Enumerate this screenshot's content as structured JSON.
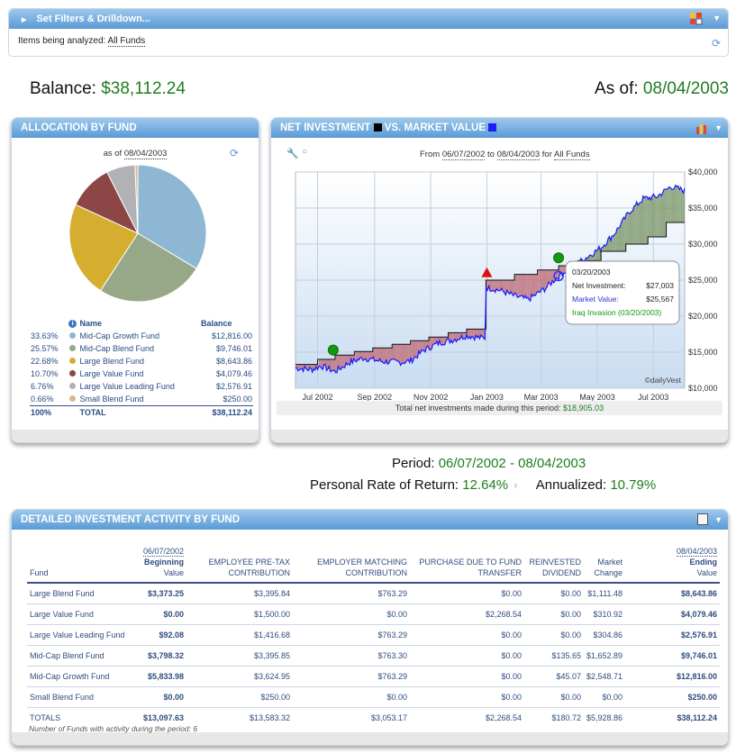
{
  "filters": {
    "header": "Set Filters & Drilldown...",
    "analyzed_label": "Items being analyzed:",
    "analyzed_value": "All Funds"
  },
  "summary": {
    "balance_label": "Balance:",
    "balance_value": "$38,112.24",
    "asof_label": "As of:",
    "asof_value": "08/04/2003"
  },
  "allocation": {
    "title": "Allocation by Fund",
    "asof_prefix": "as of",
    "asof_date": "08/04/2003",
    "col_name": "Name",
    "col_balance": "Balance",
    "rows": [
      {
        "pct": "33.63%",
        "name": "Mid-Cap Growth Fund",
        "balance": "$12,816.00",
        "color": "#8db7d2"
      },
      {
        "pct": "25.57%",
        "name": "Mid-Cap Blend Fund",
        "balance": "$9,746.01",
        "color": "#97a888"
      },
      {
        "pct": "22.68%",
        "name": "Large Blend Fund",
        "balance": "$8,643.86",
        "color": "#d5ad2f"
      },
      {
        "pct": "10.70%",
        "name": "Large Value Fund",
        "balance": "$4,079.46",
        "color": "#8c4646"
      },
      {
        "pct": "6.76%",
        "name": "Large Value Leading Fund",
        "balance": "$2,576.91",
        "color": "#b0b2b6"
      },
      {
        "pct": "0.66%",
        "name": "Small Blend Fund",
        "balance": "$250.00",
        "color": "#d9b889"
      }
    ],
    "total_pct": "100%",
    "total_label": "TOTAL",
    "total_balance": "$38,112.24"
  },
  "netinv": {
    "title_part1": "Net Investment",
    "title_part2": "vs. Market Value",
    "range_from_label": "From",
    "range_from": "06/07/2002",
    "range_to_label": "to",
    "range_to": "08/04/2003",
    "range_for_label": "for",
    "range_for": "All Funds",
    "x_ticks": [
      "Jul 2002",
      "Sep 2002",
      "Nov 2002",
      "Jan 2003",
      "Mar 2003",
      "May 2003",
      "Jul 2003"
    ],
    "y_ticks": [
      "$10,000",
      "$15,000",
      "$20,000",
      "$25,000",
      "$30,000",
      "$35,000",
      "$40,000"
    ],
    "watermark": "©dailyVest",
    "footer_label": "Total net investments made during this period:",
    "footer_value": "$18,905.03",
    "tooltip": {
      "date": "03/20/2003",
      "net_label": "Net Investment:",
      "net_value": "$27,003",
      "mkt_label": "Market Value:",
      "mkt_value": "$25,567",
      "event": "Iraq Invasion (03/20/2003)"
    }
  },
  "chart_data": {
    "type": "area",
    "title": "Net Investment vs. Market Value",
    "x_axis": "date",
    "xlim": [
      "2002-06-07",
      "2003-08-04"
    ],
    "ylim": [
      10000,
      40000
    ],
    "x_ticks": [
      "Jul 2002",
      "Sep 2002",
      "Nov 2002",
      "Jan 2003",
      "Mar 2003",
      "May 2003",
      "Jul 2003"
    ],
    "y_ticks": [
      10000,
      15000,
      20000,
      25000,
      30000,
      35000,
      40000
    ],
    "grid": true,
    "series": [
      {
        "name": "Net Investment",
        "color": "#000000",
        "points": [
          [
            "2002-06-07",
            13300
          ],
          [
            "2002-07-01",
            13300
          ],
          [
            "2002-07-01",
            14000
          ],
          [
            "2002-07-20",
            14000
          ],
          [
            "2002-07-20",
            14600
          ],
          [
            "2002-08-10",
            14600
          ],
          [
            "2002-08-10",
            15100
          ],
          [
            "2002-08-30",
            15100
          ],
          [
            "2002-08-30",
            15600
          ],
          [
            "2002-09-20",
            15600
          ],
          [
            "2002-09-20",
            16100
          ],
          [
            "2002-10-10",
            16100
          ],
          [
            "2002-10-10",
            16600
          ],
          [
            "2002-10-30",
            16600
          ],
          [
            "2002-10-30",
            17100
          ],
          [
            "2002-11-20",
            17100
          ],
          [
            "2002-11-20",
            17700
          ],
          [
            "2002-12-10",
            17700
          ],
          [
            "2002-12-10",
            18200
          ],
          [
            "2002-12-31",
            18200
          ],
          [
            "2002-12-31",
            25000
          ],
          [
            "2003-01-31",
            25000
          ],
          [
            "2003-01-31",
            25800
          ],
          [
            "2003-02-25",
            25800
          ],
          [
            "2003-02-25",
            26400
          ],
          [
            "2003-03-20",
            26400
          ],
          [
            "2003-03-20",
            27000
          ],
          [
            "2003-04-10",
            27000
          ],
          [
            "2003-04-10",
            27700
          ],
          [
            "2003-05-05",
            27700
          ],
          [
            "2003-05-05",
            29000
          ],
          [
            "2003-06-01",
            29000
          ],
          [
            "2003-06-01",
            30000
          ],
          [
            "2003-06-25",
            30000
          ],
          [
            "2003-06-25",
            31000
          ],
          [
            "2003-07-15",
            31000
          ],
          [
            "2003-07-15",
            33000
          ],
          [
            "2003-08-04",
            33000
          ]
        ]
      },
      {
        "name": "Market Value",
        "color": "#0000ff",
        "points": [
          [
            "2002-06-07",
            12800
          ],
          [
            "2002-06-25",
            12600
          ],
          [
            "2002-07-05",
            13100
          ],
          [
            "2002-07-20",
            12300
          ],
          [
            "2002-08-05",
            13600
          ],
          [
            "2002-08-20",
            14200
          ],
          [
            "2002-09-10",
            13700
          ],
          [
            "2002-09-30",
            13600
          ],
          [
            "2002-10-10",
            13800
          ],
          [
            "2002-10-25",
            15300
          ],
          [
            "2002-11-10",
            16300
          ],
          [
            "2002-11-25",
            16700
          ],
          [
            "2002-12-10",
            17300
          ],
          [
            "2002-12-30",
            16900
          ],
          [
            "2002-12-31",
            24000
          ],
          [
            "2003-01-15",
            23600
          ],
          [
            "2003-01-31",
            22800
          ],
          [
            "2003-02-15",
            22300
          ],
          [
            "2003-03-05",
            23800
          ],
          [
            "2003-03-20",
            25567
          ],
          [
            "2003-04-05",
            27000
          ],
          [
            "2003-04-20",
            28200
          ],
          [
            "2003-05-05",
            29500
          ],
          [
            "2003-05-20",
            31500
          ],
          [
            "2003-06-05",
            34500
          ],
          [
            "2003-06-20",
            36300
          ],
          [
            "2003-07-05",
            36600
          ],
          [
            "2003-07-20",
            38000
          ],
          [
            "2003-08-04",
            37400
          ]
        ]
      }
    ],
    "events": [
      {
        "date": "2002-07-18",
        "value": 15300,
        "marker": "green-circle"
      },
      {
        "date": "2003-01-01",
        "value": 25900,
        "marker": "red-triangle"
      },
      {
        "date": "2003-03-20",
        "value": 28100,
        "marker": "green-circle",
        "label": "Iraq Invasion (03/20/2003)"
      }
    ]
  },
  "performance": {
    "period_label": "Period:",
    "period_value": "06/07/2002 - 08/04/2003",
    "ror_label": "Personal Rate of Return:",
    "ror_value": "12.64%",
    "ann_label": "Annualized:",
    "ann_value": "10.79%"
  },
  "activity": {
    "title": "Detailed Investment Activity by Fund",
    "headers": {
      "fund": "Fund",
      "begin_date": "06/07/2002",
      "begin_l1": "Beginning",
      "begin_l2": "Value",
      "pretax_l1": "EMPLOYEE PRE-TAX",
      "pretax_l2": "CONTRIBUTION",
      "match_l1": "EMPLOYER MATCHING",
      "match_l2": "CONTRIBUTION",
      "transfer_l1": "PURCHASE DUE TO FUND",
      "transfer_l2": "TRANSFER",
      "reinv_l1": "REINVESTED",
      "reinv_l2": "DIVIDEND",
      "mkt_l1": "Market",
      "mkt_l2": "Change",
      "end_date": "08/04/2003",
      "end_l1": "Ending",
      "end_l2": "Value"
    },
    "rows": [
      [
        "Large Blend Fund",
        "$3,373.25",
        "$3,395.84",
        "$763.29",
        "$0.00",
        "$0.00",
        "$1,111.48",
        "$8,643.86"
      ],
      [
        "Large Value Fund",
        "$0.00",
        "$1,500.00",
        "$0.00",
        "$2,268.54",
        "$0.00",
        "$310.92",
        "$4,079.46"
      ],
      [
        "Large Value Leading Fund",
        "$92.08",
        "$1,416.68",
        "$763.29",
        "$0.00",
        "$0.00",
        "$304.86",
        "$2,576.91"
      ],
      [
        "Mid-Cap Blend Fund",
        "$3,798.32",
        "$3,395.85",
        "$763.30",
        "$0.00",
        "$135.65",
        "$1,652.89",
        "$9,746.01"
      ],
      [
        "Mid-Cap Growth Fund",
        "$5,833.98",
        "$3,624.95",
        "$763.29",
        "$0.00",
        "$45.07",
        "$2,548.71",
        "$12,816.00"
      ],
      [
        "Small Blend Fund",
        "$0.00",
        "$250.00",
        "$0.00",
        "$0.00",
        "$0.00",
        "$0.00",
        "$250.00"
      ]
    ],
    "totals": [
      "TOTALS",
      "$13,097.63",
      "$13,583.32",
      "$3,053.17",
      "$2,268.54",
      "$180.72",
      "$5,928.86",
      "$38,112.24"
    ],
    "footnote": "Number of Funds with activity during the period: 6"
  }
}
